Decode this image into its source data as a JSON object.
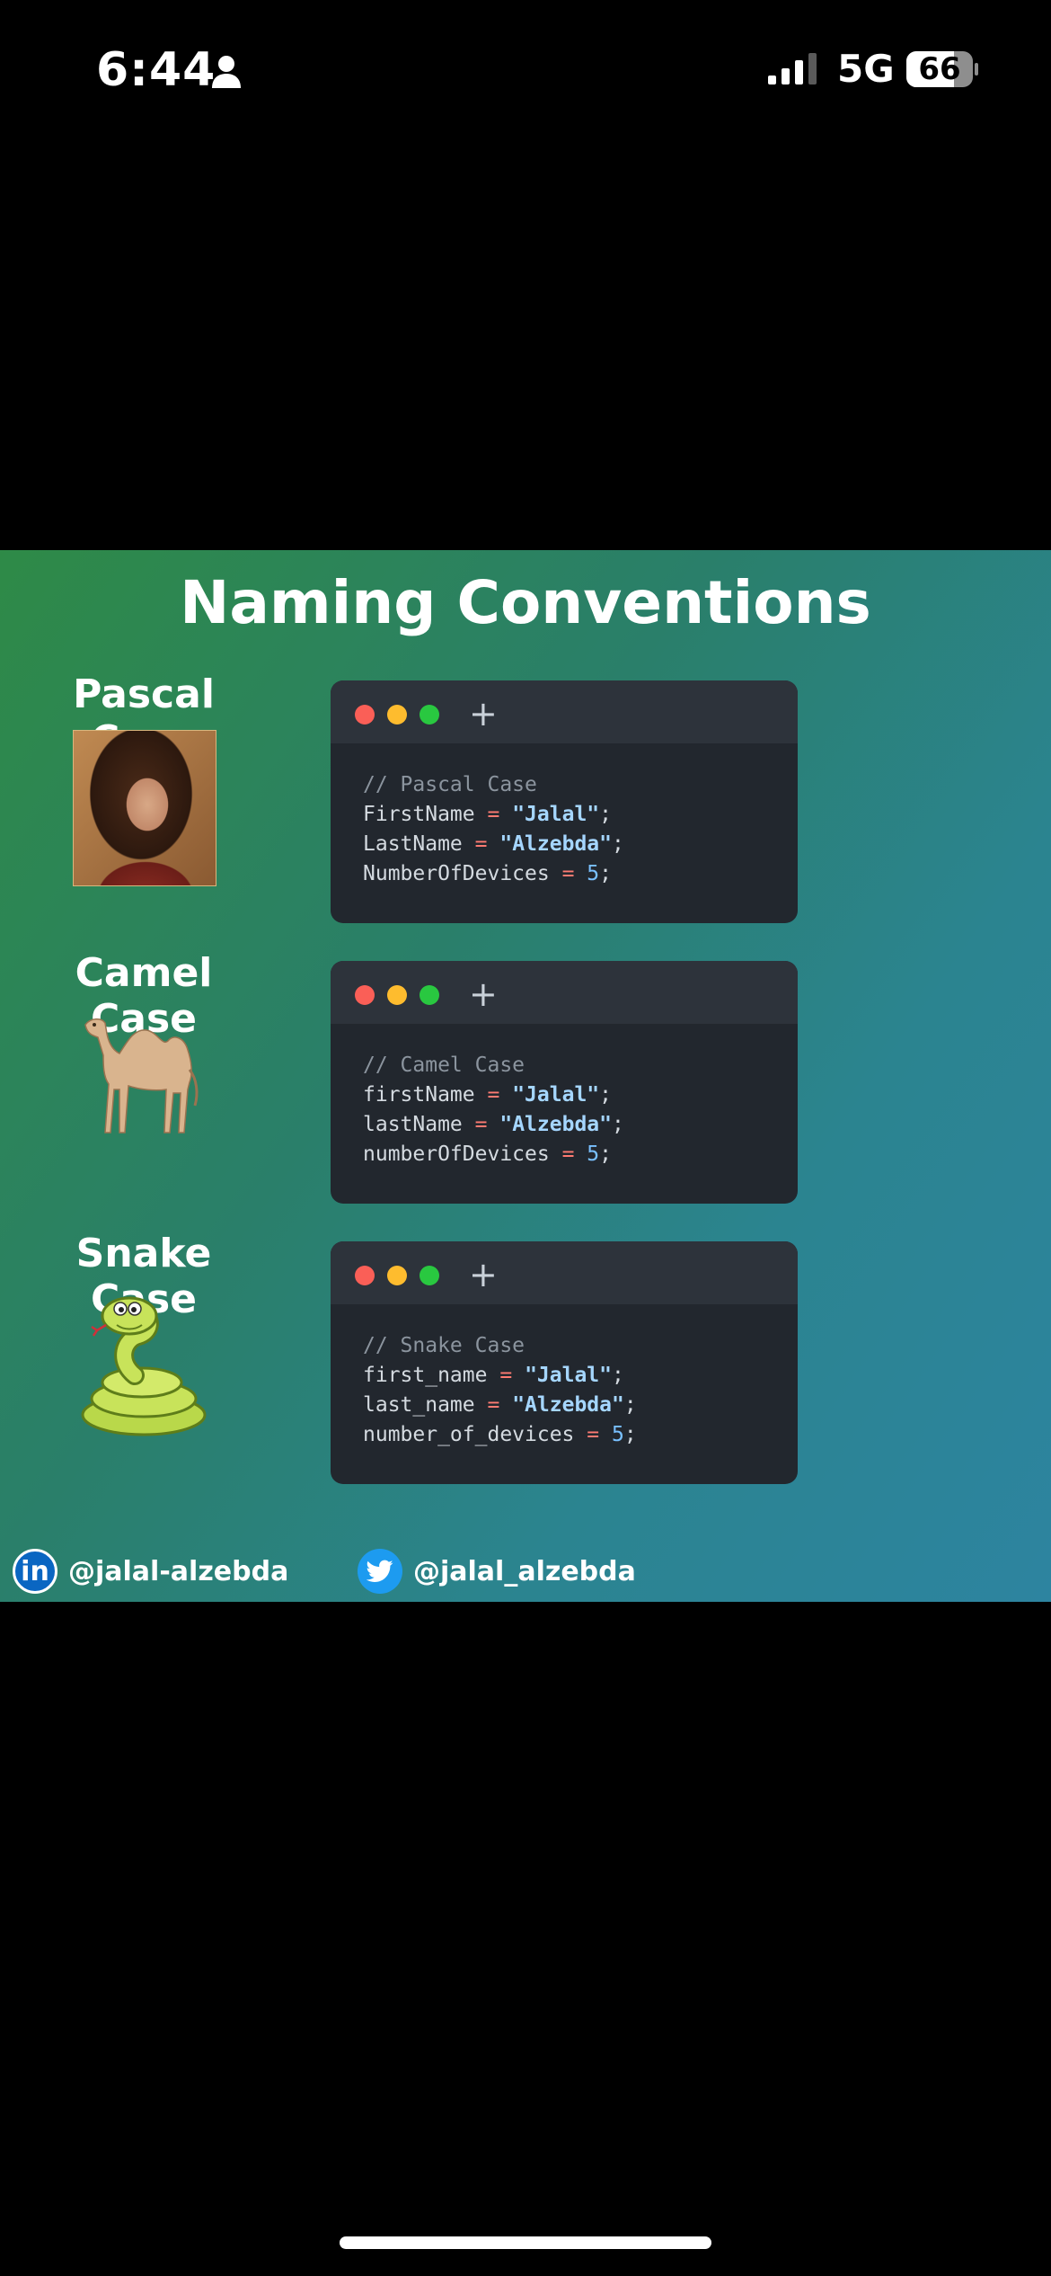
{
  "status_bar": {
    "time": "6:44",
    "network": "5G",
    "battery_level": "66",
    "icons": [
      "person-icon",
      "signal-icon",
      "battery-icon"
    ]
  },
  "poster": {
    "title": "Naming Conventions",
    "background_colors": [
      "#2e8a47",
      "#2d84a0"
    ],
    "sections": [
      {
        "label": "Pascal Case",
        "illustration": "portrait-image",
        "code": {
          "comment": "// Pascal Case",
          "lines": [
            {
              "name": "FirstName",
              "value": "\"Jalal\"",
              "end": ";"
            },
            {
              "name": "LastName",
              "value": "\"Alzebda\"",
              "end": ";"
            },
            {
              "name": "NumberOfDevices",
              "value": "5",
              "end": ";"
            }
          ]
        }
      },
      {
        "label": "Camel Case",
        "illustration": "camel-image",
        "code": {
          "comment": "// Camel Case",
          "lines": [
            {
              "name": "firstName",
              "value": "\"Jalal\"",
              "end": ";"
            },
            {
              "name": "lastName",
              "value": "\"Alzebda\"",
              "end": ";"
            },
            {
              "name": "numberOfDevices",
              "value": "5",
              "end": ";"
            }
          ]
        }
      },
      {
        "label": "Snake Case",
        "illustration": "snake-image",
        "code": {
          "comment": "// Snake Case",
          "lines": [
            {
              "name": "first_name",
              "value": "\"Jalal\"",
              "end": ";"
            },
            {
              "name": "last_name",
              "value": "\"Alzebda\"",
              "end": ";"
            },
            {
              "name": "number_of_devices",
              "value": "5",
              "end": ";"
            }
          ]
        }
      }
    ],
    "operator": "=",
    "footer": {
      "linkedin_icon_text": "in",
      "linkedin_handle": "@jalal-alzebda",
      "twitter_handle": "@jalal_alzebda"
    }
  },
  "colors": {
    "code_bg": "#22272e",
    "dot_red": "#fa5f57",
    "dot_yellow": "#febc2e",
    "dot_green": "#29c840",
    "string": "#a5d6ff",
    "number": "#79c0ff",
    "operator": "#ff7b72",
    "comment": "#8b949e"
  }
}
